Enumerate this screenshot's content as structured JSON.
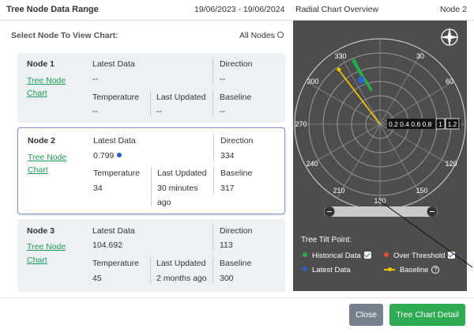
{
  "header": {
    "title": "Tree Node Data Range",
    "date_range": "19/06/2023 - 19/06/2024",
    "radial_title": "Radial Chart Overview",
    "node": "Node 2"
  },
  "select_label": "Select Node To View Chart:",
  "all_nodes_label": "All Nodes",
  "nodes": [
    {
      "name": "Node 1",
      "link": [
        "Tree Node",
        "Chart"
      ],
      "latest_label": "Latest Data",
      "latest_value": "--",
      "direction_label": "Direction",
      "direction_value": "--",
      "temperature_label": "Temperature",
      "temperature_value": "--",
      "updated_label": "Last Updated",
      "updated_value": "--",
      "baseline_label": "Baseline",
      "baseline_value": "--"
    },
    {
      "name": "Node 2",
      "link": [
        "Tree Node",
        "Chart"
      ],
      "latest_label": "Latest Data",
      "latest_value": "0.799",
      "direction_label": "Direction",
      "direction_value": "334",
      "temperature_label": "Temperature",
      "temperature_value": "34",
      "updated_label": "Last Updated",
      "updated_value": [
        "30 minutes",
        "ago"
      ],
      "baseline_label": "Baseline",
      "baseline_value": "317"
    },
    {
      "name": "Node 3",
      "link": [
        "Tree Node",
        "Chart"
      ],
      "latest_label": "Latest Data",
      "latest_value": "104.692",
      "direction_label": "Direction",
      "direction_value": "113",
      "temperature_label": "Temperature",
      "temperature_value": "45",
      "updated_label": "Last Updated",
      "updated_value": "2 months ago",
      "baseline_label": "Baseline",
      "baseline_value": "300"
    }
  ],
  "radial": {
    "angle_labels": [
      "330",
      "30",
      "300",
      "60",
      "270",
      "240",
      "120",
      "210",
      "150",
      "180"
    ],
    "radius_scale": "0.2 0.4 0.6 0.8",
    "scale_boxes": [
      "1",
      "1.2"
    ],
    "colors": {
      "panel": "#4d4d4d",
      "historical": "#22b14c",
      "over_threshold": "#e4502f",
      "latest": "#2f5fcf",
      "baseline": "#f5c400"
    }
  },
  "legend": {
    "title": "Tree Tilt Point:",
    "historical": "Historical Data",
    "over_threshold": "Over Threshold",
    "latest": "Latest Data",
    "baseline": "Baseline",
    "help_glyph": "?"
  },
  "buttons": {
    "close": "Close",
    "detail": "Tree Chart Detail"
  }
}
